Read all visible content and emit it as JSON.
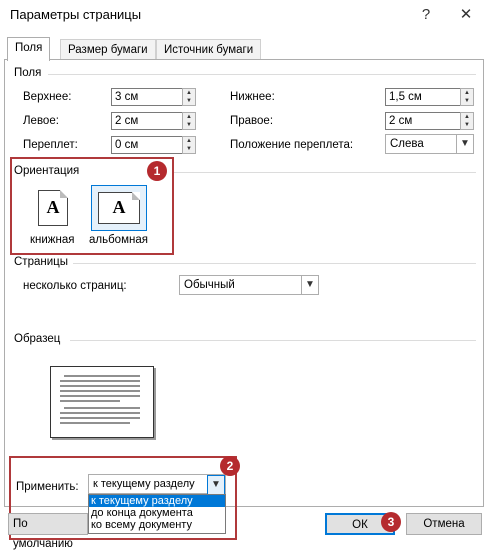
{
  "window": {
    "title": "Параметры страницы",
    "help_glyph": "?",
    "close_glyph": "✕"
  },
  "tabs": [
    {
      "label": "Поля",
      "active": true
    },
    {
      "label": "Размер бумаги",
      "active": false
    },
    {
      "label": "Источник бумаги",
      "active": false
    }
  ],
  "margins": {
    "section_title": "Поля",
    "top": {
      "label": "Верхнее:",
      "value": "3 см"
    },
    "bottom": {
      "label": "Нижнее:",
      "value": "1,5 см"
    },
    "left": {
      "label": "Левое:",
      "value": "2 см"
    },
    "right": {
      "label": "Правое:",
      "value": "2 см"
    },
    "gutter": {
      "label": "Переплет:",
      "value": "0 см"
    },
    "gutter_position": {
      "label": "Положение переплета:",
      "value": "Слева"
    }
  },
  "orientation": {
    "section_title": "Ориентация",
    "portrait_label": "книжная",
    "landscape_label": "альбомная",
    "icon_letter": "A",
    "selected": "landscape"
  },
  "pages": {
    "section_title": "Страницы",
    "multiple_label": "несколько страниц:",
    "multiple_value": "Обычный"
  },
  "preview": {
    "section_title": "Образец"
  },
  "apply": {
    "label": "Применить:",
    "value": "к текущему разделу",
    "options": [
      "к текущему разделу",
      "до конца документа",
      "ко всему документу"
    ]
  },
  "buttons": {
    "default": "По умолчанию",
    "ok": "ОК",
    "cancel": "Отмена"
  },
  "callouts": {
    "one": "1",
    "two": "2",
    "three": "3"
  },
  "colors": {
    "callout": "#b0393b",
    "badge": "#b52a2e",
    "selection": "#0078d7"
  }
}
